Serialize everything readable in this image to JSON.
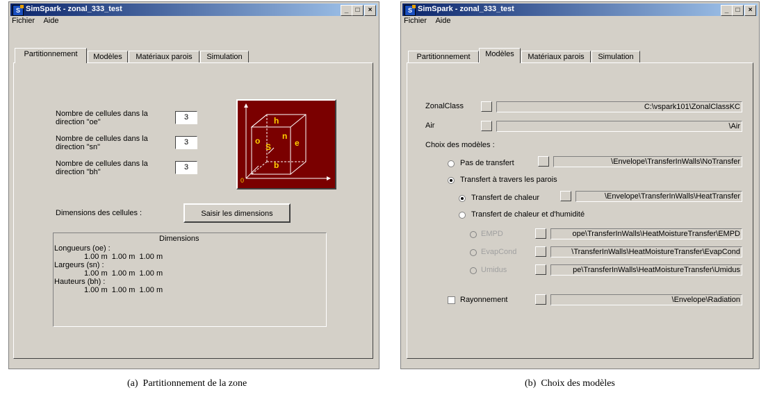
{
  "window_a": {
    "title": "SimSpark - zonal_333_test",
    "icon_label": "S",
    "controls": {
      "minimize": "_",
      "maximize": "□",
      "close": "×"
    },
    "menu": [
      "Fichier",
      "Aide"
    ],
    "tabs": [
      "Partitionnement",
      "Modèles",
      "Matériaux parois",
      "Simulation"
    ],
    "active_tab": "Partitionnement",
    "cells": [
      {
        "label1": "Nombre de cellules dans la",
        "label2": "direction \"oe\"",
        "value": "3"
      },
      {
        "label1": "Nombre de cellules dans la",
        "label2": "direction \"sn\"",
        "value": "3"
      },
      {
        "label1": "Nombre de cellules dans la",
        "label2": "direction \"bh\"",
        "value": "3"
      }
    ],
    "cube_labels": {
      "h": "h",
      "o": "o",
      "n": "n",
      "e": "e",
      "s": "S",
      "b": "b",
      "origin": "0"
    },
    "dimensions_label": "Dimensions des cellules :",
    "dimensions_button": "Saisir les dimensions",
    "dimensions_box": {
      "title": "Dimensions",
      "groups": [
        {
          "label": "Longueurs (oe) :",
          "values": "1.00 m  1.00 m  1.00 m"
        },
        {
          "label": "Largeurs (sn) :",
          "values": "1.00 m  1.00 m  1.00 m"
        },
        {
          "label": "Hauteurs (bh) :",
          "values": "1.00 m  1.00 m  1.00 m"
        }
      ]
    }
  },
  "window_b": {
    "title": "SimSpark - zonal_333_test",
    "icon_label": "S",
    "controls": {
      "minimize": "_",
      "maximize": "□",
      "close": "×"
    },
    "menu": [
      "Fichier",
      "Aide"
    ],
    "tabs": [
      "Partitionnement",
      "Modèles",
      "Matériaux parois",
      "Simulation"
    ],
    "active_tab": "Modèles",
    "zonalclass": {
      "label": "ZonalClass",
      "path": "C:\\vspark101\\ZonalClassKC"
    },
    "air": {
      "label": "Air",
      "path": "\\Air"
    },
    "choix_label": "Choix des modèles :",
    "pas_de_transfert": {
      "label": "Pas de transfert",
      "path": "\\Envelope\\TransferInWalls\\NoTransfer",
      "selected": false
    },
    "transfert_parois": {
      "label": "Transfert à travers les parois",
      "selected": true
    },
    "transfert_chaleur": {
      "label": "Transfert de chaleur",
      "path": "\\Envelope\\TransferInWalls\\HeatTransfer",
      "selected": true
    },
    "transfert_humidite": {
      "label": "Transfert de chaleur et d'humidité",
      "selected": false
    },
    "empd": {
      "label": "EMPD",
      "path": "ope\\TransferInWalls\\HeatMoistureTransfer\\EMPD"
    },
    "evapcond": {
      "label": "EvapCond",
      "path": "\\TransferInWalls\\HeatMoistureTransfer\\EvapCond"
    },
    "umidus": {
      "label": "Umidus",
      "path": "pe\\TransferInWalls\\HeatMoistureTransfer\\Umidus"
    },
    "rayonnement": {
      "label": "Rayonnement",
      "path": "\\Envelope\\Radiation",
      "checked": false
    }
  },
  "captions": {
    "a": "(a)  Partitionnement de la zone",
    "b": "(b)  Choix des modèles"
  },
  "colors": {
    "cube_bg": "#7a0000",
    "cube_label": "#ffd200",
    "titlebar": "#0a246a",
    "face": "#d4d0c8"
  }
}
